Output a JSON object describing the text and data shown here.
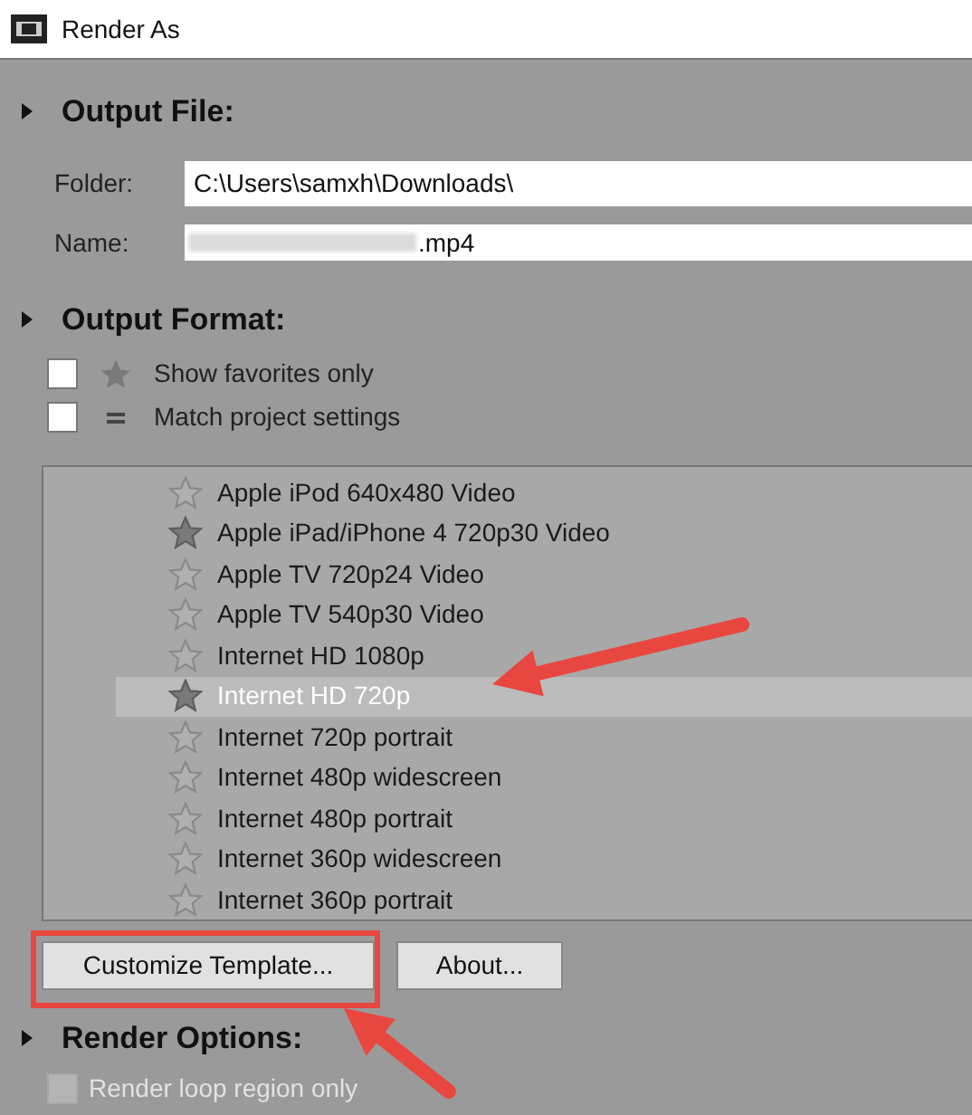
{
  "window": {
    "title": "Render As"
  },
  "output_file": {
    "heading": "Output File:",
    "expanded": true,
    "folder_label": "Folder:",
    "folder_value": "C:\\Users\\samxh\\Downloads\\",
    "name_label": "Name:",
    "name_value": ".mp4"
  },
  "output_format": {
    "heading": "Output Format:",
    "expanded": true,
    "options": [
      {
        "kind": "star",
        "label": "Show favorites only",
        "checked": false
      },
      {
        "kind": "equals",
        "label": "Match project settings",
        "checked": false
      }
    ],
    "templates": [
      {
        "label": "Apple iPod 640x480 Video",
        "favorite": false,
        "selected": false
      },
      {
        "label": "Apple iPad/iPhone 4 720p30 Video",
        "favorite": true,
        "selected": false
      },
      {
        "label": "Apple TV 720p24 Video",
        "favorite": false,
        "selected": false
      },
      {
        "label": "Apple TV 540p30 Video",
        "favorite": false,
        "selected": false
      },
      {
        "label": "Internet HD 1080p",
        "favorite": false,
        "selected": false
      },
      {
        "label": "Internet HD 720p",
        "favorite": true,
        "selected": true
      },
      {
        "label": "Internet 720p portrait",
        "favorite": false,
        "selected": false
      },
      {
        "label": "Internet 480p widescreen",
        "favorite": false,
        "selected": false
      },
      {
        "label": "Internet 480p portrait",
        "favorite": false,
        "selected": false
      },
      {
        "label": "Internet 360p widescreen",
        "favorite": false,
        "selected": false
      },
      {
        "label": "Internet 360p portrait",
        "favorite": false,
        "selected": false
      }
    ],
    "buttons": [
      {
        "label": "Customize Template...",
        "highlighted": true
      },
      {
        "label": "About...",
        "highlighted": false
      }
    ]
  },
  "render_options": {
    "heading": "Render Options:",
    "expanded": true,
    "options": [
      {
        "label": "Render loop region only",
        "checked": false,
        "disabled": true
      }
    ]
  },
  "annotations": [
    {
      "kind": "arrow",
      "color": "#e8473f"
    },
    {
      "kind": "arrow",
      "color": "#e8473f"
    }
  ]
}
